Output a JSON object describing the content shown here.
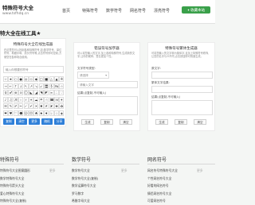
{
  "site": {
    "title": "特殊符号大全",
    "url": "www.tsfhdq.cn"
  },
  "nav": [
    "首页",
    "特殊符号",
    "数学符号",
    "网名符号",
    "漂亮符号"
  ],
  "favorite_label": "收藏本站",
  "hero_title": "特大全在线工具★",
  "left_panel": {
    "title": "特殊符号大全在线生成器",
    "desc": "在这里您可以找到各种特殊符号,如:数学符号、单位符号、希腊字母、箭头符号等,点击符号即可复制,方便您在各种场合使用。",
    "input_placeholder": "输入你想要的符号",
    "symbols": [
      [
        "☆",
        "★",
        "○",
        "●",
        "◎",
        "◇",
        "◆",
        "□",
        "■",
        "△",
        "▲",
        "※"
      ],
      [
        "→",
        "←",
        "↑",
        "↓",
        "↖",
        "↗",
        "↘",
        "↙",
        "〓",
        "§",
        "№",
        "☆"
      ],
      [
        "♀",
        "♂",
        "⊕",
        "⊙",
        "〇",
        "◣",
        "◢",
        "◥",
        "◤",
        "∞",
        "∴",
        "∵"
      ],
      [
        "♪",
        "♫",
        "♬",
        "♭",
        "♯",
        "☀",
        "☁",
        "☂",
        "☃",
        "☎",
        "☏",
        "✈"
      ],
      [
        "✉",
        "✎",
        "✐",
        "✂",
        "✓",
        "✔",
        "✕",
        "✖",
        "✗",
        "✘",
        "❀",
        "✿"
      ],
      [
        "❤",
        "♥",
        "♡",
        "☻",
        "☺",
        "☹",
        "♣",
        "♠",
        "♦",
        "♧",
        "♤",
        "◈"
      ]
    ],
    "buttons": [
      "复制",
      "清空",
      "更多",
      "随机",
      "分享"
    ]
  },
  "center_panel": {
    "title": "错误符号加字器",
    "desc": "可以将您输入的文字,加上各种特殊符号,生成新的文字,让你的昵称、签名更加个性。",
    "label1": "文字符号类型:",
    "select_value": "请选择",
    "input_placeholder": "请输入文字",
    "label2": "结果(点复制,不可输入)",
    "buttons": [
      "生成",
      "复制",
      "清空"
    ]
  },
  "right_panel": {
    "title": "特殊符号繁体生成器",
    "desc": "可将您输入的文字转为繁体字,且加上特殊符号修饰,让您的名字与众不同,点击按钮即可快速生成。",
    "label1": "原文字:",
    "label2": "繁体文字结果:",
    "label3": "结果(点复制,不可输入)",
    "buttons": [
      "生成",
      "复制",
      "清空"
    ]
  },
  "sections": [
    {
      "title": "特殊符号",
      "more": "更多",
      "items": [
        "特殊符号大全图案圆形",
        "数学特殊符号大全",
        "特殊符号箭头大全",
        "爱心特殊符号大全",
        "特殊符号大全(复制)"
      ]
    },
    {
      "title": "数学符号",
      "more": "更多",
      "items": [
        "数学符号大全",
        "数学符号大全(复制)",
        "数学运算符号大全",
        "罗马数字",
        "希腊字母大全"
      ]
    },
    {
      "title": "网名符号",
      "more": "更多",
      "items": [
        "网名符号特殊符号大全",
        "个性网名符号大全",
        "好看的网名符号",
        "情侣网名符号大全",
        "可爱网名符号"
      ]
    }
  ]
}
